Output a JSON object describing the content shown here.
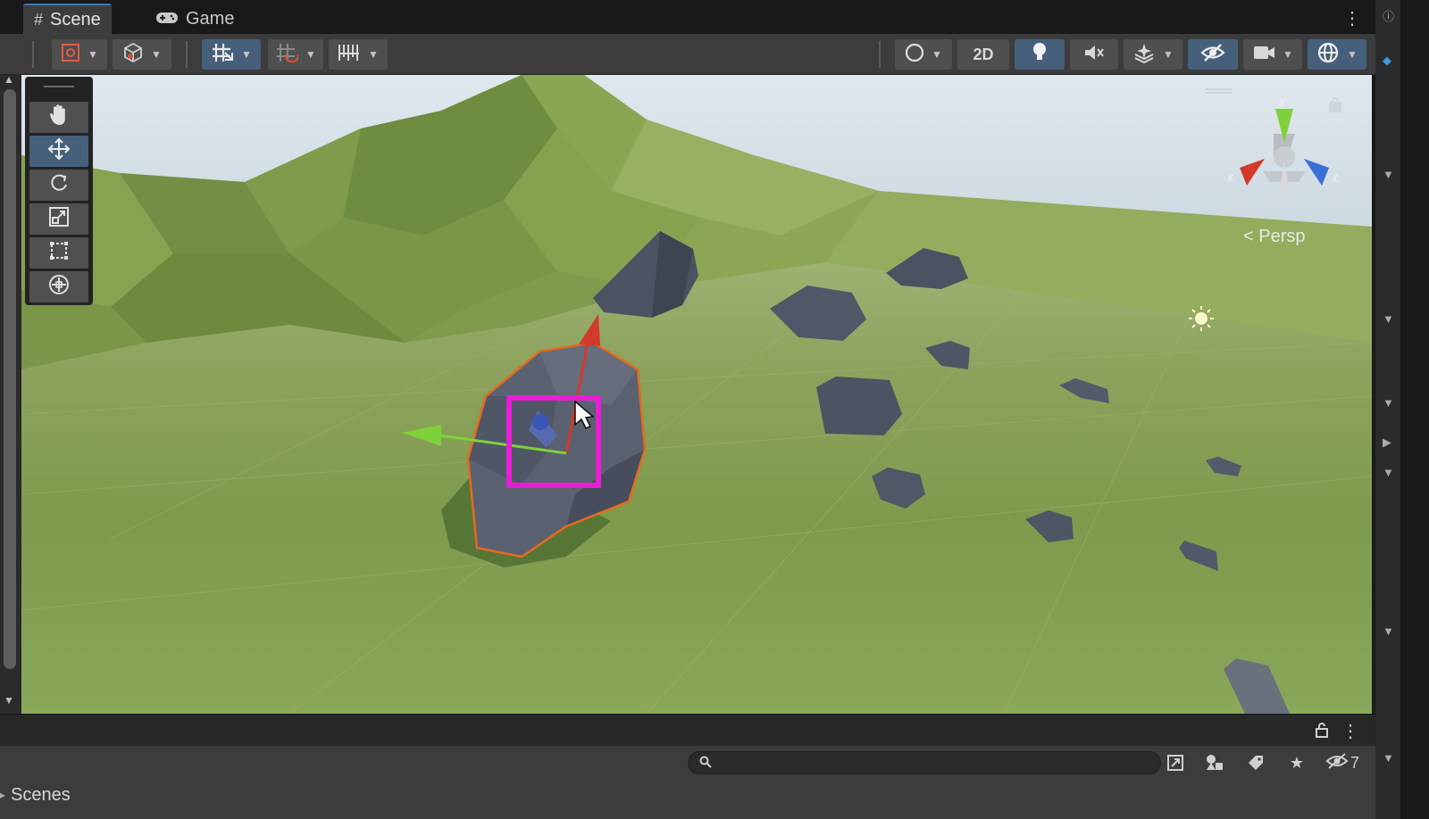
{
  "tabs": [
    {
      "label": "Scene",
      "icon": "hash-icon",
      "active": true
    },
    {
      "label": "Game",
      "icon": "gamepad-icon",
      "active": false
    }
  ],
  "toolbar": {
    "mode_2d_label": "2D",
    "buttons": [
      "draw-mode",
      "render-mode",
      "grid-snapping",
      "increment-snap",
      "align-grid",
      "shading",
      "2d-toggle",
      "lighting",
      "audio",
      "effects",
      "visibility",
      "camera",
      "gizmos"
    ]
  },
  "tools": [
    "hand-tool",
    "move-tool",
    "rotate-tool",
    "scale-tool",
    "rect-tool",
    "transform-tool"
  ],
  "scene": {
    "projection_label": "Persp",
    "axis_labels": {
      "x": "x",
      "y": "y",
      "z": "z"
    },
    "colors": {
      "x_axis": "#d23a2a",
      "y_axis": "#7fd13a",
      "z_axis": "#3a6fd8",
      "selection": "#e46a1c",
      "highlight_box": "#e81ed6"
    }
  },
  "hierarchy": {
    "search_placeholder": "",
    "hidden_count": "7",
    "scenes_label": "Scenes"
  }
}
